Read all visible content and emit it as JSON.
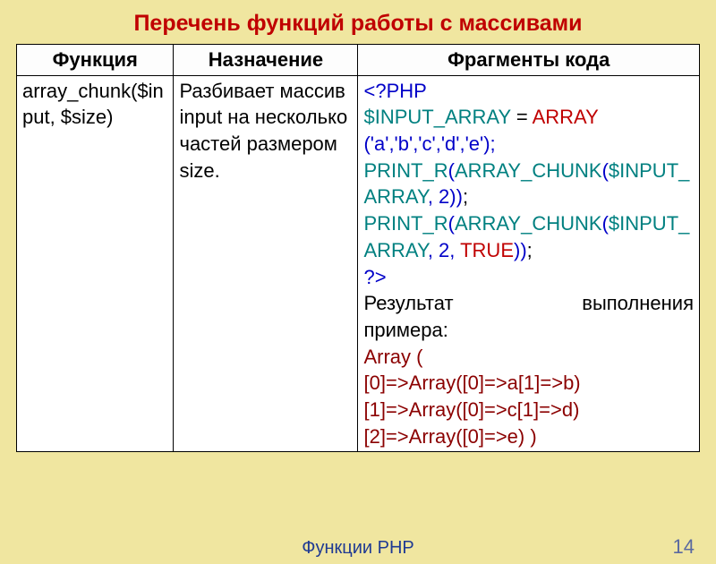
{
  "title": "Перечень функций работы с массивами",
  "headers": {
    "c1": "Функция",
    "c2": "Назначение",
    "c3": "Фрагменты кода"
  },
  "row": {
    "func": "array_chunk($input, $size)",
    "desc": "Разбивает массив input на несколько частей размером size."
  },
  "code": {
    "open": "<?PHP",
    "l1a": "$INPUT_ARRAY",
    "l1b": " = ",
    "l1c": "ARRAY",
    "l2": "('a','b','c','d','e');",
    "l3a": "PRINT_R",
    "l3b": "(",
    "l3c": "ARRAY_CHUNK",
    "l3d": "(",
    "l3e": "$INPUT_ARRAY",
    "l3f": ", 2",
    "l3g": "))",
    "l3h": ";",
    "l4a": "PRINT_R",
    "l4b": "(",
    "l4c": "ARRAY_CHUNK",
    "l4d": "(",
    "l4e": "$INPUT_ARRAY",
    "l4f": ", 2, ",
    "l4g": "TRUE",
    "l4h": "))",
    "l4i": ";",
    "close": "?>"
  },
  "result": {
    "hdr_left": "Результат",
    "hdr_right": "выполнения",
    "hdr2": "примера:",
    "r0": "Array (",
    "r1": "[0]=>Array([0]=>a[1]=>b)",
    "r2": "[1]=>Array([0]=>c[1]=>d)",
    "r3": "[2]=>Array([0]=>e) )"
  },
  "footer": "Функции PHP",
  "page": "14"
}
